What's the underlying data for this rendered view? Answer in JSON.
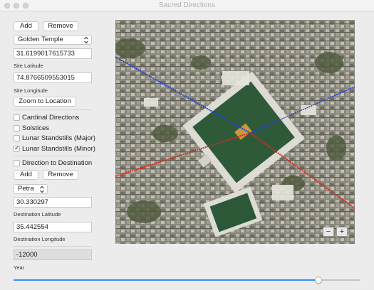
{
  "window": {
    "title": "Sacred Directions"
  },
  "site": {
    "add_label": "Add",
    "remove_label": "Remove",
    "selected": "Golden Temple",
    "latitude_value": "31.6199017615733",
    "latitude_label": "Site Latitude",
    "longitude_value": "74.8766509553015",
    "longitude_label": "Site Longitude",
    "zoom_label": "Zoom to Location"
  },
  "options": [
    {
      "label": "Cardinal Directions",
      "checked": false
    },
    {
      "label": "Solstices",
      "checked": false
    },
    {
      "label": "Lunar Standstills (Major)",
      "checked": false
    },
    {
      "label": "Lunar Standstills (Minor)",
      "checked": true
    },
    {
      "label": "Direction to Destination",
      "checked": false
    }
  ],
  "check_mark": "✓",
  "destination": {
    "add_label": "Add",
    "remove_label": "Remove",
    "selected": "Petra",
    "latitude_value": "30.330297",
    "latitude_label": "Destination Latitude",
    "longitude_value": "35.442554",
    "longitude_label": "Destination Longitude"
  },
  "year": {
    "value": "-12000",
    "label": "Year",
    "slider_fraction": 0.88
  },
  "map": {
    "zoom_out": "−",
    "zoom_in": "+",
    "line_colors": {
      "blue": "#1f3fd8",
      "red": "#d8281f"
    }
  }
}
